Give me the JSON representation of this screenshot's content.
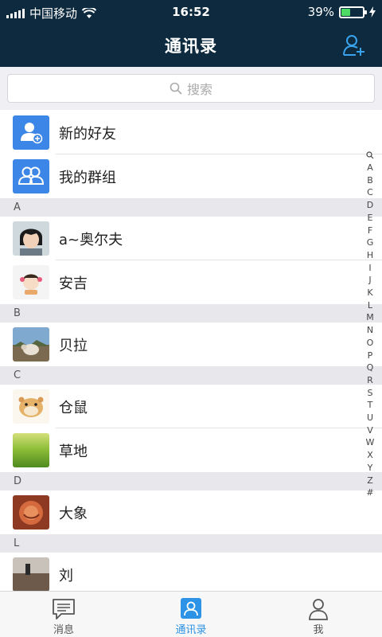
{
  "status": {
    "carrier": "中国移动",
    "time": "16:52",
    "battery": "39%",
    "battery_level": 0.39
  },
  "nav": {
    "title": "通讯录"
  },
  "search": {
    "placeholder": "搜索"
  },
  "special": [
    {
      "label": "新的好友",
      "icon": "add-user-icon"
    },
    {
      "label": "我的群组",
      "icon": "group-icon"
    }
  ],
  "sections": [
    {
      "letter": "A",
      "items": [
        "a~奥尔夫",
        "安吉"
      ]
    },
    {
      "letter": "B",
      "items": [
        "贝拉"
      ]
    },
    {
      "letter": "C",
      "items": [
        "仓鼠",
        "草地"
      ]
    },
    {
      "letter": "D",
      "items": [
        "大象"
      ]
    },
    {
      "letter": "L",
      "items": [
        "刘"
      ]
    }
  ],
  "index": [
    "A",
    "B",
    "C",
    "D",
    "E",
    "F",
    "G",
    "H",
    "I",
    "J",
    "K",
    "L",
    "M",
    "N",
    "O",
    "P",
    "Q",
    "R",
    "S",
    "T",
    "U",
    "V",
    "W",
    "X",
    "Y",
    "Z",
    "#"
  ],
  "tabs": [
    {
      "label": "消息",
      "icon": "message-icon",
      "active": false
    },
    {
      "label": "通讯录",
      "icon": "contacts-icon",
      "active": true
    },
    {
      "label": "我",
      "icon": "profile-icon",
      "active": false
    }
  ],
  "colors": {
    "header": "#0d2a3f",
    "accent": "#2c93e6",
    "special_icon_bg": "#3b86e6"
  }
}
